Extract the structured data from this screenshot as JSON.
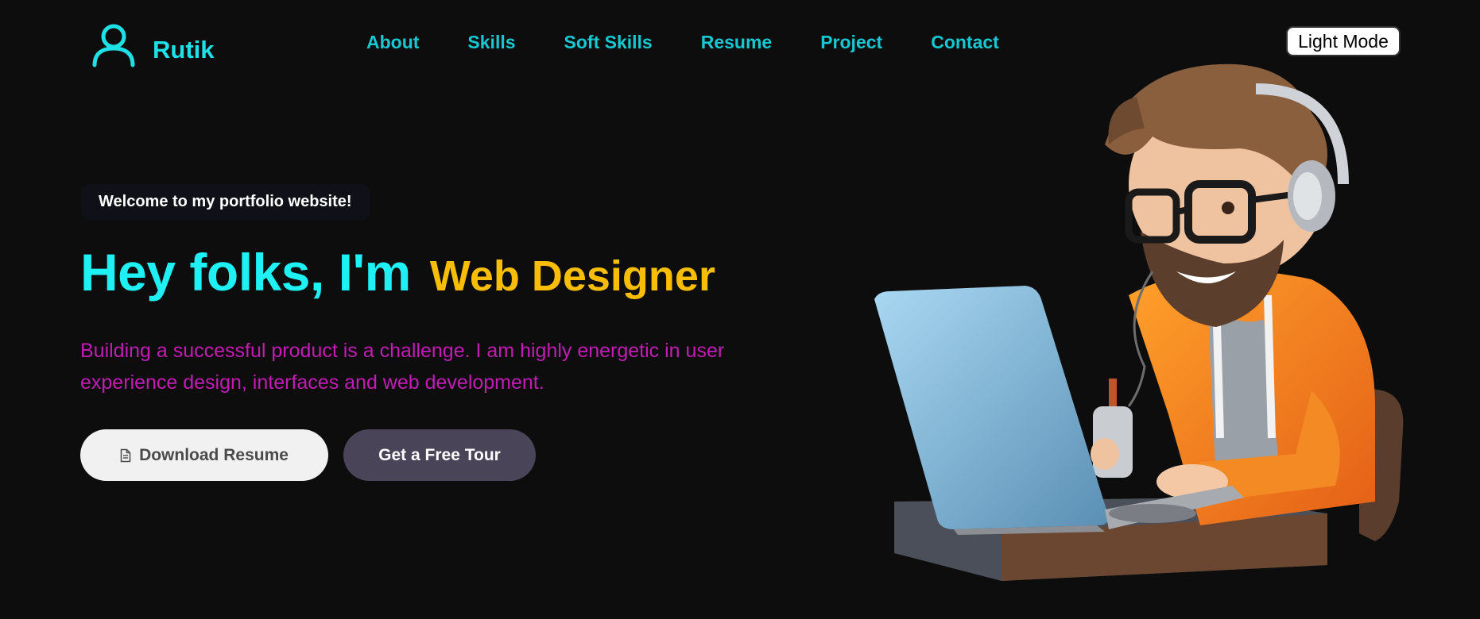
{
  "brand": {
    "name": "Rutik",
    "icon": "user-icon"
  },
  "nav": {
    "items": [
      {
        "label": "About"
      },
      {
        "label": "Skills"
      },
      {
        "label": "Soft Skills"
      },
      {
        "label": "Resume"
      },
      {
        "label": "Project"
      },
      {
        "label": "Contact"
      }
    ]
  },
  "theme_toggle": {
    "label": "Light Mode"
  },
  "hero": {
    "welcome": "Welcome to my portfolio website!",
    "greeting": "Hey folks, I'm",
    "role": "Web Designer",
    "description": "Building a successful product is a challenge. I am highly energetic in user experience design, interfaces and web development.",
    "download_label": "Download Resume",
    "download_icon": "document-icon",
    "tour_label": "Get a Free Tour",
    "illustration": "developer-avatar-illustration"
  },
  "colors": {
    "background": "#0d0d0d",
    "accent_cyan": "#1ef0f3",
    "nav_cyan": "#17c8d2",
    "role_yellow": "#f8be07",
    "description_magenta": "#c21cb5",
    "tour_button": "#4a4458"
  }
}
